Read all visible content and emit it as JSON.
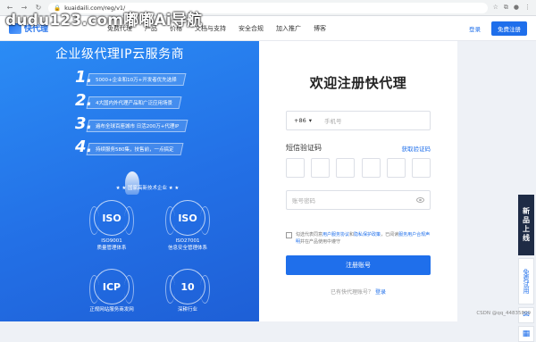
{
  "watermark": "dudu123.com嘟嘟Ai导航",
  "browser": {
    "url": "kuaidaili.com/reg/v1/"
  },
  "header": {
    "logo_text": "快代理",
    "nav": [
      "免费代理",
      "产品",
      "价格",
      "文档与支持",
      "安全合规",
      "加入推广",
      "博客"
    ],
    "login": "登录",
    "register": "免费注册"
  },
  "left": {
    "title": "企业级代理IP云服务商",
    "features": [
      {
        "num": "1.",
        "text": "5000+企业和10万+开发者优先选择"
      },
      {
        "num": "2.",
        "text": "4大国内外代理产品和广泛应用场景"
      },
      {
        "num": "3.",
        "text": "遍布全球百座城市 日活200万+代理IP"
      },
      {
        "num": "4.",
        "text": "持续服务580集，技售前，一点搞定"
      }
    ],
    "tech_label": "★ ★ 国家高新技术企业 ★ ★",
    "certs": [
      {
        "badge": "ISO",
        "line1": "ISO9001",
        "line2": "质量管理体系"
      },
      {
        "badge": "ISO",
        "line1": "ISO27001",
        "line2": "信息安全管理体系"
      },
      {
        "badge": "ICP",
        "line1": "",
        "line2": "正规网站服务商发网"
      },
      {
        "badge": "10",
        "line1": "",
        "line2": "深耕行业"
      }
    ]
  },
  "form": {
    "title": "欢迎注册快代理",
    "country_code": "+86",
    "phone_placeholder": "手机号",
    "sms_label": "短信验证码",
    "sms_link": "获取验证码",
    "password_placeholder": "账号密码",
    "agree_text_1": "勾选代表同意",
    "agree_link_1": "用户服务协议",
    "agree_text_2": "和",
    "agree_link_2": "隐私保护政策",
    "agree_text_3": "，已阅读",
    "agree_link_3": "服务用户合规声明",
    "agree_text_4": "并在产品使用中遵守",
    "submit": "注册账号",
    "login_prompt": "已有快代理账号？",
    "login_link": "登录"
  },
  "float_bar": {
    "dark": "新品上线",
    "light": "免费试用"
  },
  "csdn_mark": "CSDN @qq_44835809"
}
